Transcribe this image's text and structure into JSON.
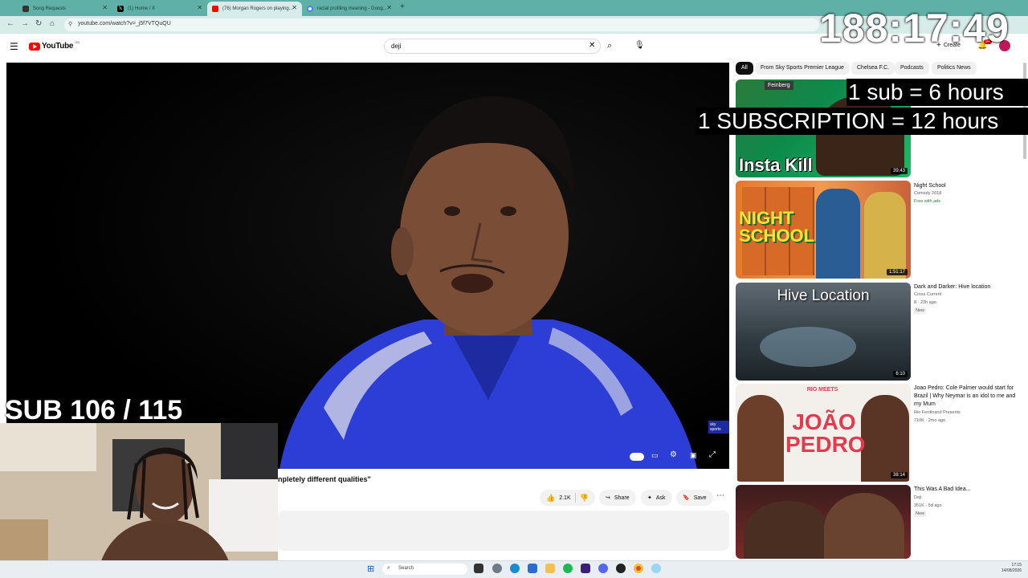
{
  "browser": {
    "tabs": [
      {
        "label": "Song Requests",
        "active": false
      },
      {
        "label": "(1) Home / X",
        "active": false
      },
      {
        "label": "(76) Morgan Rogers on playing...",
        "active": true
      },
      {
        "label": "racial profiling meaning - Goog...",
        "active": false
      }
    ],
    "url": "youtube.com/watch?v=_j5f7VTQuQU"
  },
  "youtube": {
    "logo": "YouTube",
    "region": "GB",
    "search_value": "deji",
    "create_label": "Create",
    "notif_count": "9+"
  },
  "chips": [
    "All",
    "From Sky Sports Premier League",
    "Chelsea F.C.",
    "Podcasts",
    "Politics News"
  ],
  "video": {
    "title_visible": "npletely different qualities\"",
    "likes": "2.1K",
    "share_label": "Share",
    "ask_label": "Ask",
    "save_label": "Save",
    "watermark": "sky sports"
  },
  "sidebar": [
    {
      "thumb_text": "Insta Kill",
      "thumb_tag": "Feinberg",
      "duration": "39:43",
      "title": "",
      "channel": "",
      "stats": "",
      "badge": ""
    },
    {
      "thumb_text": "NIGHT SCHOOL",
      "duration": "1:51:17",
      "title": "Night School",
      "channel": "Comedy 2018",
      "stats": "",
      "badge": "Free with ads"
    },
    {
      "thumb_text": "Hive Location",
      "duration": "6:10",
      "title": "Dark and Darker: Hive location",
      "channel": "Cross Current",
      "stats": "8 · 23h ago",
      "badge": "New"
    },
    {
      "thumb_text": "JOÃO PEDRO",
      "thumb_tag": "RIO MEETS",
      "duration": "38:14",
      "title": "Joao Pedro: Cole Palmer would start for Brazil | Why Neymar is an idol to me and my Mum",
      "channel": "Rio Ferdinand Presents",
      "stats": "710K · 2mo ago",
      "badge": ""
    },
    {
      "thumb_text": "",
      "duration": "",
      "title": "This Was A Bad Idea...",
      "channel": "Deji",
      "stats": "351K · 5d ago",
      "badge": "New"
    }
  ],
  "overlay": {
    "timer": "188:17:49",
    "sub_line": "1 sub = 6 hours",
    "subscription_line": "1 SUBSCRIPTION = 12 hours",
    "sub_counter": "SUB 106 / 115"
  },
  "taskbar": {
    "search_label": "Search",
    "time": "17:15",
    "date": "14/08/2026"
  },
  "colors": {
    "tabbar": "#5fb0a6",
    "youtube_red": "#ff0000",
    "jersey_blue": "#2c3ed6"
  }
}
